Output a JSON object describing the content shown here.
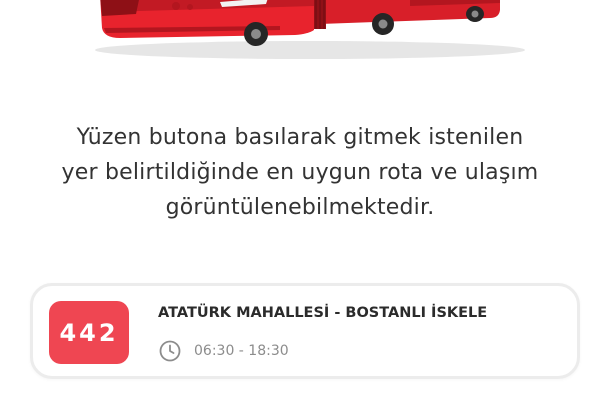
{
  "illustration": {
    "icon": "bus-icon",
    "body_color": "#e8232d",
    "dark_color": "#a8141c"
  },
  "info": {
    "line1": "Yüzen butona basılarak gitmek istenilen",
    "line2": "yer belirtildiğinde en uygun rota ve ulaşım",
    "line3": "görüntülenebilmektedir."
  },
  "route": {
    "number": "442",
    "name": "ATATÜRK MAHALLESİ - BOSTANLI İSKELE",
    "hours": "06:30 - 18:30",
    "badge_color": "#ef4652",
    "icon": "clock-icon"
  }
}
